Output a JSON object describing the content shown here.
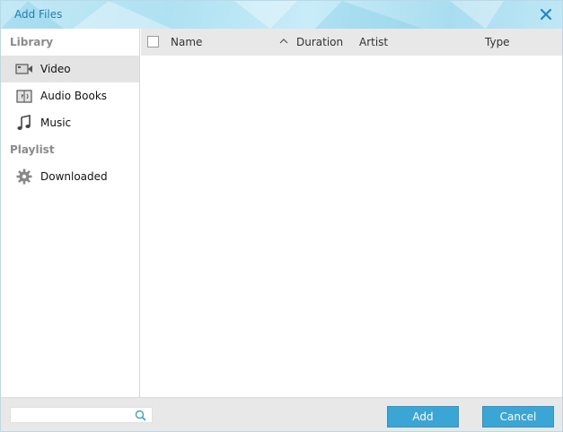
{
  "window": {
    "title": "Add Files"
  },
  "sidebar": {
    "sections": [
      {
        "label": "Library"
      },
      {
        "label": "Playlist"
      }
    ],
    "items": [
      {
        "label": "Video",
        "icon": "video-icon",
        "active": true
      },
      {
        "label": "Audio Books",
        "icon": "audiobook-icon",
        "active": false
      },
      {
        "label": "Music",
        "icon": "music-note-icon",
        "active": false
      },
      {
        "label": "Downloaded",
        "icon": "gear-icon",
        "active": false
      }
    ]
  },
  "table": {
    "columns": [
      "Name",
      "Duration",
      "Artist",
      "Type"
    ],
    "sort_icon": "chevron-up-icon",
    "rows": []
  },
  "footer": {
    "search": {
      "value": "",
      "placeholder": ""
    },
    "add_label": "Add",
    "cancel_label": "Cancel"
  },
  "colors": {
    "accent": "#3ba6d6",
    "title_text": "#1f7fb0",
    "header_bg": "#e8e8e8"
  }
}
